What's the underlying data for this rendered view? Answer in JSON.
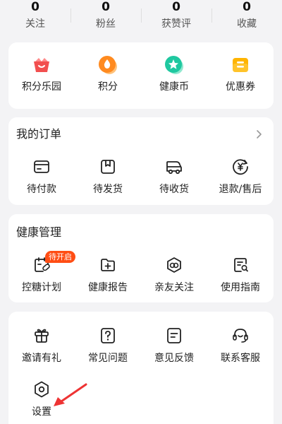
{
  "stats": [
    {
      "value": "0",
      "label": "关注"
    },
    {
      "value": "0",
      "label": "粉丝"
    },
    {
      "value": "0",
      "label": "获赞评"
    },
    {
      "value": "0",
      "label": "收藏"
    }
  ],
  "points": {
    "items": [
      {
        "label": "积分乐园",
        "icon": "basket-icon",
        "color": "#f24f4f"
      },
      {
        "label": "积分",
        "icon": "drop-coin-icon",
        "color": "#ff8a1f"
      },
      {
        "label": "健康币",
        "icon": "star-coin-icon",
        "color": "#1fc8a0"
      },
      {
        "label": "优惠券",
        "icon": "coupon-icon",
        "color": "#ffb400"
      }
    ]
  },
  "orders": {
    "title": "我的订单",
    "items": [
      {
        "label": "待付款",
        "icon": "card-icon"
      },
      {
        "label": "待发货",
        "icon": "box-icon"
      },
      {
        "label": "待收货",
        "icon": "truck-icon"
      },
      {
        "label": "退款/售后",
        "icon": "refund-icon"
      }
    ]
  },
  "health": {
    "title": "健康管理",
    "badge": "待开启",
    "items": [
      {
        "label": "控糖计划",
        "icon": "calendar-pill-icon"
      },
      {
        "label": "健康报告",
        "icon": "folder-plus-icon"
      },
      {
        "label": "亲友关注",
        "icon": "friends-icon"
      },
      {
        "label": "使用指南",
        "icon": "guide-icon"
      }
    ]
  },
  "more": {
    "items": [
      {
        "label": "邀请有礼",
        "icon": "gift-icon"
      },
      {
        "label": "常见问题",
        "icon": "question-icon"
      },
      {
        "label": "意见反馈",
        "icon": "feedback-icon"
      },
      {
        "label": "联系客服",
        "icon": "headset-icon"
      },
      {
        "label": "设置",
        "icon": "settings-icon"
      }
    ]
  },
  "colors": {
    "accent_arrow": "#ee3333",
    "badge": "#ff4d14"
  }
}
